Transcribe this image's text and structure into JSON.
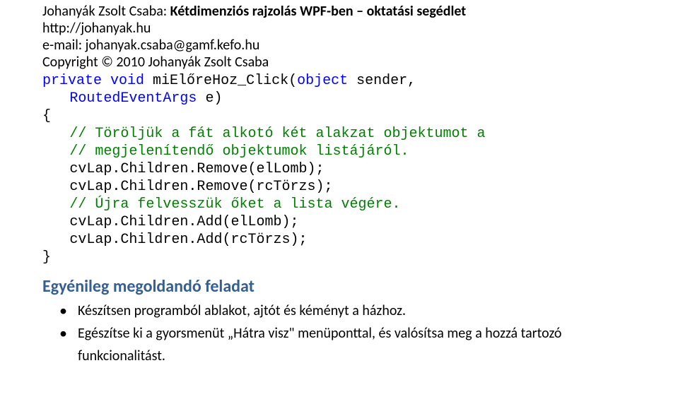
{
  "header": {
    "author": "Johanyák Zsolt Csaba: ",
    "title": "Kétdimenziós rajzolás WPF-ben – oktatási segédlet",
    "link": "http://johanyak.hu",
    "email": "e-mail: johanyak.csaba@gamf.kefo.hu",
    "copyright": "Copyright © 2010 Johanyák Zsolt Csaba"
  },
  "code": {
    "l1a": "private",
    "l1b": " ",
    "l1c": "void",
    "l1d": " miElőreHoz_Click(",
    "l1e": "object",
    "l1f": " sender,",
    "l2a": "RoutedEventArgs",
    "l2b": " e)",
    "l3": "{",
    "l4": "// Töröljük a fát alkotó két alakzat objektumot a",
    "l5": "// megjelenítendő objektumok listájáról.",
    "l6": "cvLap.Children.Remove(elLomb);",
    "l7": "cvLap.Children.Remove(rcTörzs);",
    "l8": "// Újra felvesszük őket a lista végére.",
    "l9": "cvLap.Children.Add(elLomb);",
    "l10": "cvLap.Children.Add(rcTörzs);",
    "l11": "}"
  },
  "section": {
    "heading": "Egyénileg megoldandó feladat"
  },
  "tasks": {
    "t1": "Készítsen programból ablakot, ajtót és kéményt a házhoz.",
    "t2": "Egészítse ki a gyorsmenüt „Hátra visz\" menüponttal, és valósítsa meg a hozzá tartozó funkcionalitást."
  }
}
